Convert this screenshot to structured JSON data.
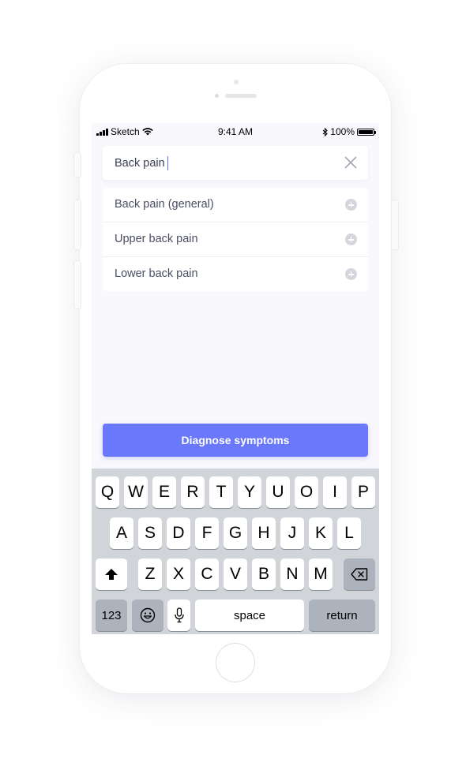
{
  "status_bar": {
    "carrier": "Sketch",
    "time": "9:41 AM",
    "battery": "100%"
  },
  "search": {
    "value": "Back pain",
    "clear_icon": "close-icon"
  },
  "results": [
    {
      "label": "Back pain (general)",
      "icon": "plus-circle-icon"
    },
    {
      "label": "Upper back pain",
      "icon": "plus-circle-icon"
    },
    {
      "label": "Lower back pain",
      "icon": "plus-circle-icon"
    }
  ],
  "cta": {
    "label": "Diagnose symptoms",
    "color": "#6a78fb"
  },
  "keyboard": {
    "row1": [
      "Q",
      "W",
      "E",
      "R",
      "T",
      "Y",
      "U",
      "O",
      "I",
      "P"
    ],
    "row2": [
      "A",
      "S",
      "D",
      "F",
      "G",
      "H",
      "J",
      "K",
      "L"
    ],
    "row3": [
      "Z",
      "X",
      "C",
      "V",
      "B",
      "N",
      "M"
    ],
    "numbers_label": "123",
    "space_label": "space",
    "return_label": "return"
  }
}
